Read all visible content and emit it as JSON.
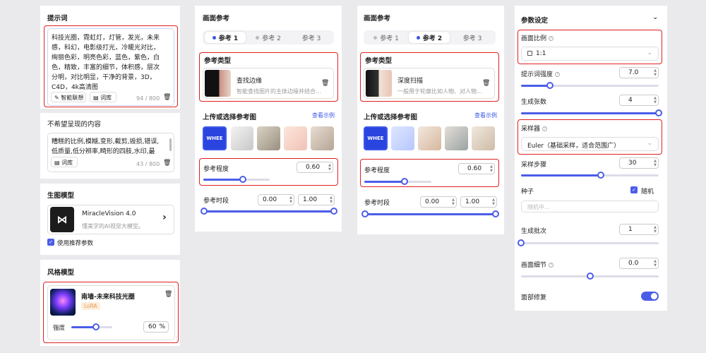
{
  "col1": {
    "prompt_title": "提示词",
    "prompt_lines": [
      "科技光圈，霓虹灯，灯管，发光，未来",
      "感，科幻，电影级打光，冷暖光对比，",
      "绚丽色彩，明亮色彩，蓝色，紫色，白",
      "色，精致，丰富的细节，体积感，层次",
      "分明，对比明显，干净的背景，3D，",
      "C4D，4k高清图"
    ],
    "smart_assoc": "智能联想",
    "library": "词库",
    "prompt_count": "94 / 800",
    "neg_title": "不希望呈现的内容",
    "neg_lines": [
      "糟糕的比例,模糊,变形,截剪,毁损,错误,",
      "低质量,低分辨率,畸形的四肢,水印,最"
    ],
    "neg_library": "词库",
    "neg_count": "43 / 800",
    "model_title": "生图模型",
    "model_name": "MiracleVision 4.0",
    "model_desc": "懂美学的AI视觉大模型。",
    "model_arrow": "›",
    "use_recommended": "使用推荐参数",
    "style_title": "风格模型",
    "style_name": "南墙-未来科技光圈",
    "style_tag": "LoRA",
    "strength_label": "强度",
    "strength_value": "60",
    "strength_unit": "%",
    "strength_fraction": 0.6
  },
  "col2": {
    "title": "画面参考",
    "tabs": [
      "参考 1",
      "参考 2",
      "参考 3"
    ],
    "ref_type_label": "参考类型",
    "ref_type_name": "查找边缘",
    "ref_type_desc": "智能查找图片的主体边缘并结合...",
    "upload_label": "上传或选择参考图",
    "view_example": "查看示例",
    "strength_label": "参考程度",
    "strength_value": "0.60",
    "strength_fraction": 0.6,
    "period_label": "参考时段",
    "period_start": "0.00",
    "period_end": "1.00"
  },
  "col3": {
    "title": "画面参考",
    "tabs": [
      "参考 1",
      "参考 2",
      "参考 3"
    ],
    "ref_type_label": "参考类型",
    "ref_type_name": "深度扫描",
    "ref_type_desc": "一般用于轮廓比如人物、对人物...",
    "upload_label": "上传或选择参考图",
    "view_example": "查看示例",
    "strength_label": "参考程度",
    "strength_value": "0.60",
    "strength_fraction": 0.6,
    "period_label": "参考时段",
    "period_start": "0.00",
    "period_end": "1.00"
  },
  "col4": {
    "title": "参数设定",
    "ratio_label": "画面比例",
    "ratio_value": "1:1",
    "prompt_strength_label": "提示词强度",
    "prompt_strength_value": "7.0",
    "prompt_strength_fraction": 0.21,
    "count_label": "生成张数",
    "count_value": "4",
    "count_fraction": 1.0,
    "sampler_label": "采样器",
    "sampler_value": "Euler（基础采样，适合范围广）",
    "steps_label": "采样步骤",
    "steps_value": "30",
    "steps_fraction": 0.58,
    "seed_label": "种子",
    "seed_random_label": "随机",
    "seed_placeholder": "随机中...",
    "batch_label": "生成批次",
    "batch_value": "1",
    "batch_fraction": 0.0,
    "detail_label": "画面细节",
    "detail_value": "0.0",
    "detail_fraction": 0.5,
    "face_fix_label": "面部修复",
    "face_fix_on": true
  },
  "colors": {
    "accent": "#4b5de8",
    "highlight": "#e02020",
    "lora_bg": "#fdeedd",
    "lora_text": "#e79a50"
  },
  "thumb_labels": [
    "WHEE"
  ]
}
